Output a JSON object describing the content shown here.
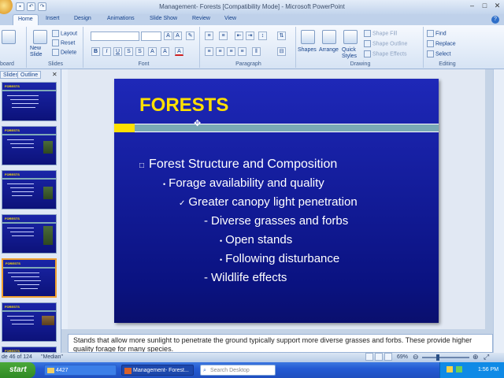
{
  "window": {
    "title": "Management- Forests [Compatibility Mode] - Microsoft PowerPoint"
  },
  "ribbon": {
    "tabs": [
      "Home",
      "Insert",
      "Design",
      "Animations",
      "Slide Show",
      "Review",
      "View"
    ],
    "active_tab": "Home",
    "clipboard": {
      "label": "board",
      "paste": "Paste"
    },
    "slides": {
      "label": "Slides",
      "new_slide": "New Slide",
      "layout": "Layout",
      "reset": "Reset",
      "delete": "Delete"
    },
    "font": {
      "label": "Font"
    },
    "paragraph": {
      "label": "Paragraph"
    },
    "drawing": {
      "label": "Drawing",
      "shapes": "Shapes",
      "arrange": "Arrange",
      "quick_styles": "Quick Styles",
      "shape_fill": "Shape Fill",
      "shape_outline": "Shape Outline",
      "shape_effects": "Shape Effects"
    },
    "editing": {
      "label": "Editing",
      "find": "Find",
      "replace": "Replace",
      "select": "Select"
    }
  },
  "left_pane": {
    "tabs": [
      "Slides",
      "Outline"
    ],
    "thumb_title": "FORESTS"
  },
  "slide": {
    "title": "FORESTS",
    "bullets": [
      {
        "level": 0,
        "marker": "□",
        "text": "Forest Structure and Composition"
      },
      {
        "level": 1,
        "marker": "•",
        "text": "Forage availability and quality"
      },
      {
        "level": 2,
        "marker": "✓",
        "text": "Greater canopy light penetration"
      },
      {
        "level": 3,
        "marker": "-",
        "text": "Diverse grasses and forbs"
      },
      {
        "level": 4,
        "marker": "•",
        "text": "Open stands"
      },
      {
        "level": 4,
        "marker": "•",
        "text": "Following disturbance"
      },
      {
        "level": 3,
        "marker": "-",
        "text": "Wildlife effects"
      }
    ]
  },
  "notes": {
    "text": "Stands that allow more sunlight to penetrate the ground typically support more diverse grasses and forbs.  These provide higher quality forage for many species."
  },
  "status": {
    "slide_info": "de 46 of 124",
    "theme": "\"Median\"",
    "zoom": "69%"
  },
  "taskbar": {
    "start": "start",
    "items": [
      "4427",
      "Management- Forest...",
      "Search Desktop"
    ],
    "clock": "1:56 PM"
  }
}
